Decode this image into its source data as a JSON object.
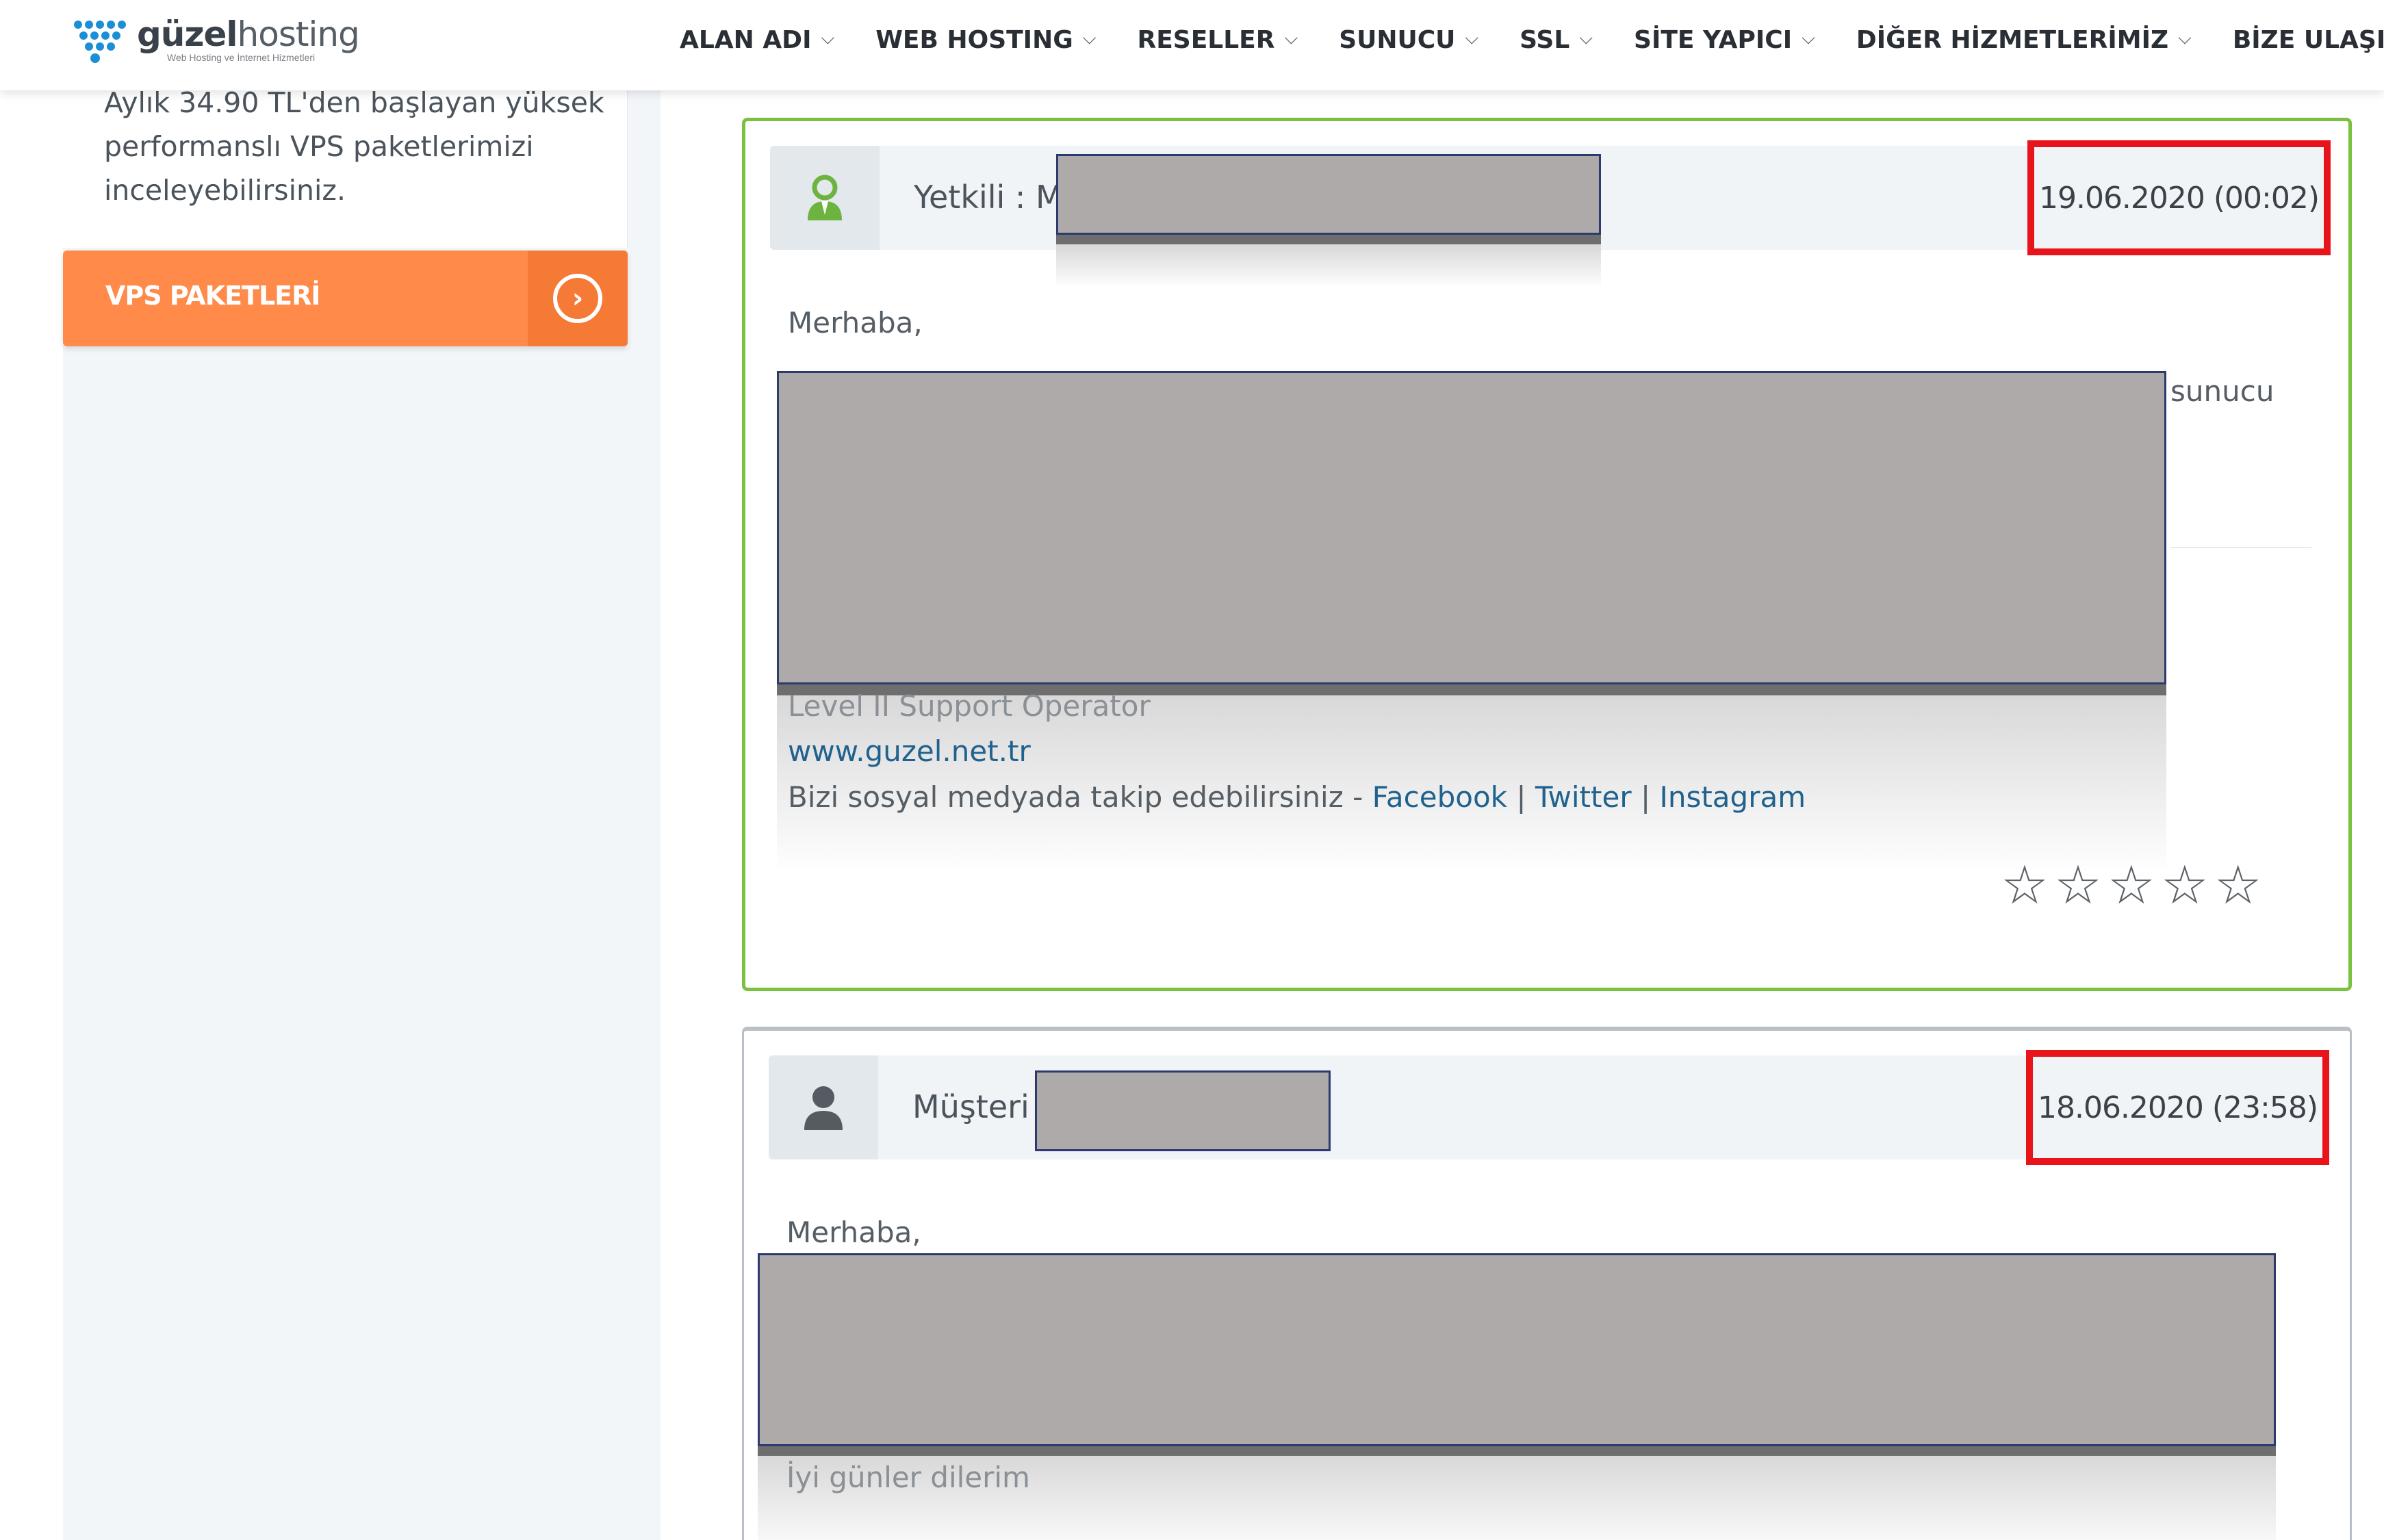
{
  "brand": {
    "name_bold": "güzel",
    "name_light": "hosting",
    "tagline": "Web Hosting ve İnternet Hizmetleri"
  },
  "nav": {
    "items": [
      {
        "label": "ALAN ADI"
      },
      {
        "label": "WEB HOSTING"
      },
      {
        "label": "RESELLER"
      },
      {
        "label": "SUNUCU"
      },
      {
        "label": "SSL"
      },
      {
        "label": "SİTE YAPICI"
      },
      {
        "label": "DİĞER HİZMETLERİMİZ"
      },
      {
        "label": "BİZE ULAŞIN"
      }
    ]
  },
  "sidebar": {
    "promo_text": "Aylık 34.90 TL'den başlayan yüksek performanslı VPS paketlerimizi inceleyebilirsiniz.",
    "vps_button_label": "VPS PAKETLERİ"
  },
  "messages": [
    {
      "role_label": "Yetkili : M",
      "date": "19.06.2020 (00:02)",
      "greeting": "Merhaba,",
      "trailing_word": "sunucu",
      "signature_title": "Level II Support Operator",
      "signature_site": "www.guzel.net.tr",
      "social_prefix": "Bizi sosyal medyada takip edebilirsiniz - ",
      "social_links": [
        "Facebook",
        "Twitter",
        "Instagram"
      ],
      "separator": " | ",
      "rating_stars": 5,
      "rating_value": 0
    },
    {
      "role_label": "Müşteri",
      "date": "18.06.2020 (23:58)",
      "greeting": "Merhaba,",
      "closing": "İyi günler dilerim"
    }
  ],
  "colors": {
    "accent_orange": "#ff8a4a",
    "staff_border": "#7ac13f",
    "highlight_red": "#e8131b",
    "link_blue": "#20628e"
  }
}
